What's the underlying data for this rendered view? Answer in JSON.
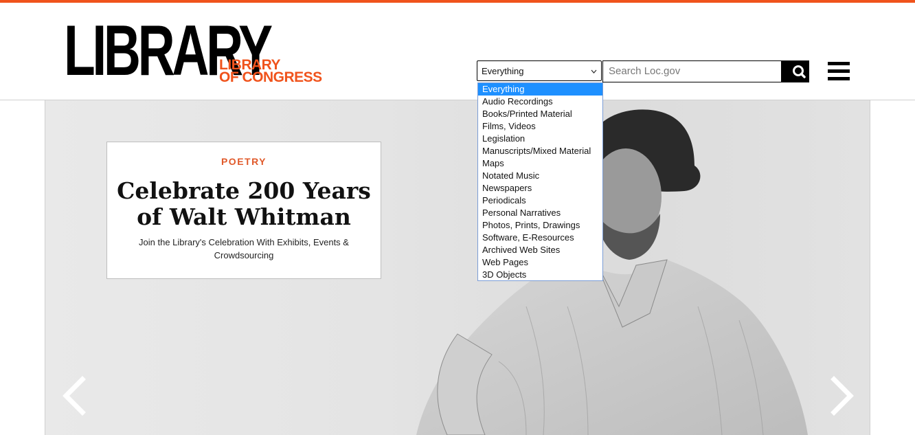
{
  "brand": {
    "logo_main": "LIBRARY",
    "logo_sub_line1": "LIBRARY",
    "logo_sub_line2": "OF CONGRESS",
    "accent_color": "#f0531c"
  },
  "search": {
    "selected_scope": "Everything",
    "placeholder": "Search Loc.gov",
    "button_icon": "search-icon"
  },
  "menu": {
    "icon": "hamburger-menu-icon"
  },
  "dropdown": {
    "options": [
      "Everything",
      "Audio Recordings",
      "Books/Printed Material",
      "Films, Videos",
      "Legislation",
      "Manuscripts/Mixed Material",
      "Maps",
      "Notated Music",
      "Newspapers",
      "Periodicals",
      "Personal Narratives",
      "Photos, Prints, Drawings",
      "Software, E-Resources",
      "Archived Web Sites",
      "Web Pages",
      "3D Objects"
    ],
    "highlighted": "Everything"
  },
  "hero": {
    "kicker": "POETRY",
    "title_line1": "Celebrate 200 Years",
    "title_line2": "of Walt Whitman",
    "subtitle": "Join the Library's Celebration With Exhibits, Events & Crowdsourcing",
    "prev_icon": "chevron-left-icon",
    "next_icon": "chevron-right-icon"
  }
}
